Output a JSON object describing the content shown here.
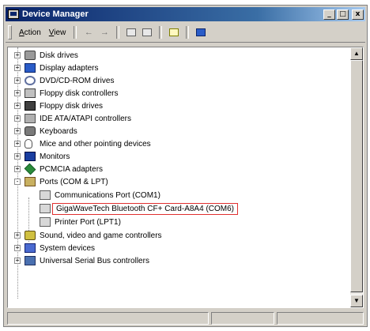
{
  "window": {
    "title": "Device Manager"
  },
  "titlebar_buttons": {
    "minimize": "_",
    "maximize": "□",
    "close": "x"
  },
  "menu": {
    "items": [
      {
        "label": "Action"
      },
      {
        "label": "View"
      }
    ]
  },
  "toolbar": {
    "back_glyph": "←",
    "forward_glyph": "→"
  },
  "tree": {
    "nodes": [
      {
        "label": "Disk drives",
        "icon": "disk-drive-icon",
        "expander": "+",
        "level": 1
      },
      {
        "label": "Display adapters",
        "icon": "display-adapter-icon",
        "expander": "+",
        "level": 1
      },
      {
        "label": "DVD/CD-ROM drives",
        "icon": "dvd-drive-icon",
        "expander": "+",
        "level": 1
      },
      {
        "label": "Floppy disk controllers",
        "icon": "floppy-controller-icon",
        "expander": "+",
        "level": 1
      },
      {
        "label": "Floppy disk drives",
        "icon": "floppy-drive-icon",
        "expander": "+",
        "level": 1
      },
      {
        "label": "IDE ATA/ATAPI controllers",
        "icon": "ide-controller-icon",
        "expander": "+",
        "level": 1
      },
      {
        "label": "Keyboards",
        "icon": "keyboard-icon",
        "expander": "+",
        "level": 1
      },
      {
        "label": "Mice and other pointing devices",
        "icon": "mouse-icon",
        "expander": "+",
        "level": 1
      },
      {
        "label": "Monitors",
        "icon": "monitor-icon",
        "expander": "+",
        "level": 1
      },
      {
        "label": "PCMCIA adapters",
        "icon": "pcmcia-icon",
        "expander": "+",
        "level": 1
      },
      {
        "label": "Ports (COM & LPT)",
        "icon": "port-icon",
        "expander": "-",
        "level": 1
      },
      {
        "label": "Communications Port (COM1)",
        "icon": "com-port-icon",
        "level": 2
      },
      {
        "label": "GigaWaveTech Bluetooth CF+ Card-A8A4 (COM6)",
        "icon": "com-port-icon",
        "level": 2,
        "selected": true
      },
      {
        "label": "Printer Port (LPT1)",
        "icon": "com-port-icon",
        "level": 2
      },
      {
        "label": "Sound, video and game controllers",
        "icon": "sound-icon",
        "expander": "+",
        "level": 1
      },
      {
        "label": "System devices",
        "icon": "system-device-icon",
        "expander": "+",
        "level": 1
      },
      {
        "label": "Universal Serial Bus controllers",
        "icon": "usb-icon",
        "expander": "+",
        "level": 1
      }
    ]
  },
  "scrollbar": {
    "up_glyph": "▲",
    "down_glyph": "▼"
  },
  "colors": {
    "title_bar": "#0a246a",
    "window_face": "#d4d0c8",
    "selection_outline": "#e03030"
  }
}
